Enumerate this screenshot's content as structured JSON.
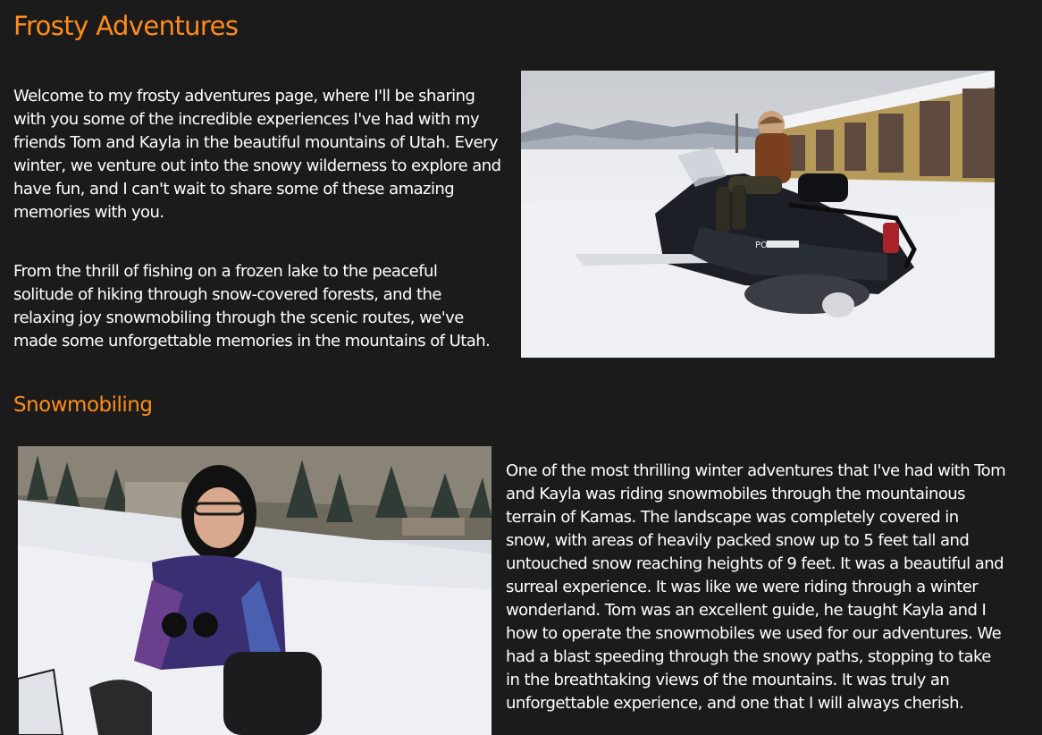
{
  "page": {
    "title": "Frosty Adventures",
    "intro_paragraph_1": "Welcome to my frosty adventures page, where I'll be sharing with you some of the incredible experiences I've had with my friends Tom and Kayla in the beautiful mountains of Utah. Every winter, we venture out into the snowy wilderness to explore and have fun, and I can't wait to share some of these amazing memories with you.",
    "intro_paragraph_2": "From the thrill of fishing on a frozen lake to the peaceful solitude of hiking through snow-covered forests, and the relaxing joy snowmobiling through the scenic routes, we've made some unforgettable memories in the mountains of Utah."
  },
  "snowmobiling": {
    "heading": "Snowmobiling",
    "paragraph": "One of the most thrilling winter adventures that I've had with Tom and Kayla was riding snowmobiles through the mountainous terrain of Kamas. The landscape was completely covered in snow, with areas of heavily packed snow up to 5 feet tall and untouched snow reaching heights of 9 feet. It was a beautiful and surreal experience. It was like we were riding through a winter wonderland. Tom was an excellent guide, he taught Kayla and I how to operate the snowmobiles we used for our adventures. We had a blast speeding through the snowy paths, stopping to take in the breathtaking views of the mountains. It was truly an unforgettable experience, and one that I will always cherish."
  },
  "photos": {
    "rider_logo_text": "POLARIS"
  },
  "colors": {
    "background": "#1b1b1b",
    "heading_accent": "#ff8c1a",
    "body_text": "#ffffff"
  }
}
